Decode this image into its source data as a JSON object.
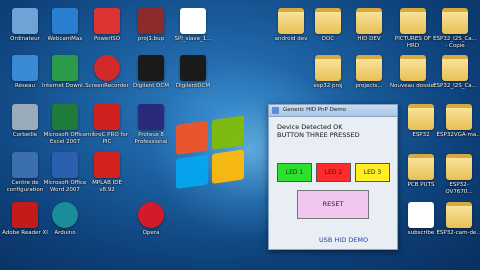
{
  "desktop_icons": [
    {
      "label": "Ordinateur",
      "color": "#6fa3d8"
    },
    {
      "label": "WebcamMax",
      "color": "#2a7fd0"
    },
    {
      "label": "PowerISO",
      "color": "#d33"
    },
    {
      "label": "proj1.bup",
      "color": "#8b2b2b"
    },
    {
      "label": "SPI_slave_1...",
      "color": "#ffffff"
    },
    {
      "label": "Réseau",
      "color": "#3a8bd3"
    },
    {
      "label": "Internet Downl...",
      "color": "#2a9b4a"
    },
    {
      "label": "ScreenRecorder",
      "color": "#d02a2a"
    },
    {
      "label": "Digilent DCM",
      "color": "#1a1a1a"
    },
    {
      "label": "DigilentDCM",
      "color": "#1a1a1a"
    },
    {
      "label": "Corbeille",
      "color": "#9ab"
    },
    {
      "label": "Microsoft Office Excel 2007",
      "color": "#1e7b3a"
    },
    {
      "label": "mikroC PRO for PIC",
      "color": "#d02020"
    },
    {
      "label": "Proteus 8 Professional",
      "color": "#2a2a7a"
    },
    {
      "label": "Centre de configuration",
      "color": "#3b6fb0"
    },
    {
      "label": "Microsoft Office Word 2007",
      "color": "#2b5faf"
    },
    {
      "label": "MPLAB IDE v8.92",
      "color": "#d52020"
    },
    {
      "label": "Adobe Reader XI",
      "color": "#c31a1a"
    },
    {
      "label": "Arduino",
      "color": "#1a8c9a"
    },
    {
      "label": "Opera",
      "color": "#d21a2a"
    }
  ],
  "right_icons": [
    {
      "label": "android dev"
    },
    {
      "label": "DOC"
    },
    {
      "label": "HID DEV"
    },
    {
      "label": "PICTURES OF HRD"
    },
    {
      "label": "ESP32_I2S_Ca... - Copie"
    },
    {
      "label": "esp32 proj"
    },
    {
      "label": "projects..."
    },
    {
      "label": "Nouveau dossier"
    },
    {
      "label": "ESP32_I2S_Ca..."
    },
    {
      "label": "ESP32"
    },
    {
      "label": "ESP32VGA-ma..."
    },
    {
      "label": "PCB PUTS"
    },
    {
      "label": "ESP32-OV7670..."
    },
    {
      "label": "subscribe"
    },
    {
      "label": "ESP32-cam-de..."
    }
  ],
  "dialog": {
    "title": "Generic HID PnP Demo",
    "status_line1": "Device Detected OK",
    "status_line2": "BUTTON THREE PRESSED",
    "led1": "LED 1",
    "led2": "LED 2",
    "led3": "LED 3",
    "led1_color": "#2de02d",
    "led2_color": "#ff2a2a",
    "led3_color": "#ffee22",
    "reset_label": "RESET",
    "footer": "USB HID DEMO"
  }
}
